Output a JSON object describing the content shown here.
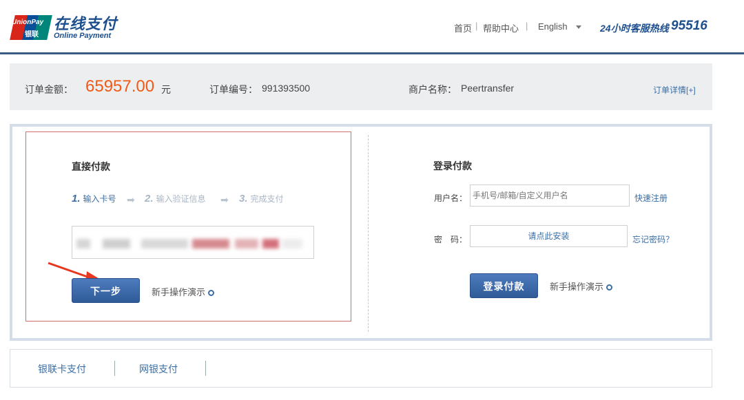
{
  "header": {
    "logo_badge_text": "UnionPay",
    "logo_badge_cn": "银联",
    "logo_title": "在线支付",
    "logo_subtitle": "Online Payment",
    "nav": {
      "home": "首页",
      "help": "帮助中心",
      "language": "English",
      "separator": "|"
    },
    "hotline_label": "24小时客服热线",
    "hotline_number": "95516"
  },
  "order": {
    "amount_label": "订单金额：",
    "amount": "65957.00",
    "amount_unit": "元",
    "number_label": "订单编号：",
    "number": "991393500",
    "merchant_label": "商户名称：",
    "merchant": "Peertransfer",
    "detail_link": "订单详情[+]"
  },
  "direct_pay": {
    "title": "直接付款",
    "steps": [
      {
        "num": "1.",
        "label": "输入卡号"
      },
      {
        "num": "2.",
        "label": "输入验证信息"
      },
      {
        "num": "3.",
        "label": "完成支付"
      }
    ],
    "card_input_value": "",
    "next_button": "下一步",
    "guide_link": "新手操作演示"
  },
  "login_pay": {
    "title": "登录付款",
    "username_label": "用户名：",
    "username_placeholder": "手机号/邮箱/自定义用户名",
    "register_link": "快速注册",
    "password_label": "密　码：",
    "password_placeholder": "请点此安装",
    "forgot_link": "忘记密码？",
    "login_button": "登录付款",
    "guide_link": "新手操作演示"
  },
  "bottom_tabs": [
    {
      "label": "银联卡支付"
    },
    {
      "label": "网银支付"
    }
  ],
  "colors": {
    "brand_blue": "#1d4f8f",
    "amount_orange": "#f05a16",
    "button_blue": "#3a68a8",
    "highlight_red": "#cf7068"
  }
}
